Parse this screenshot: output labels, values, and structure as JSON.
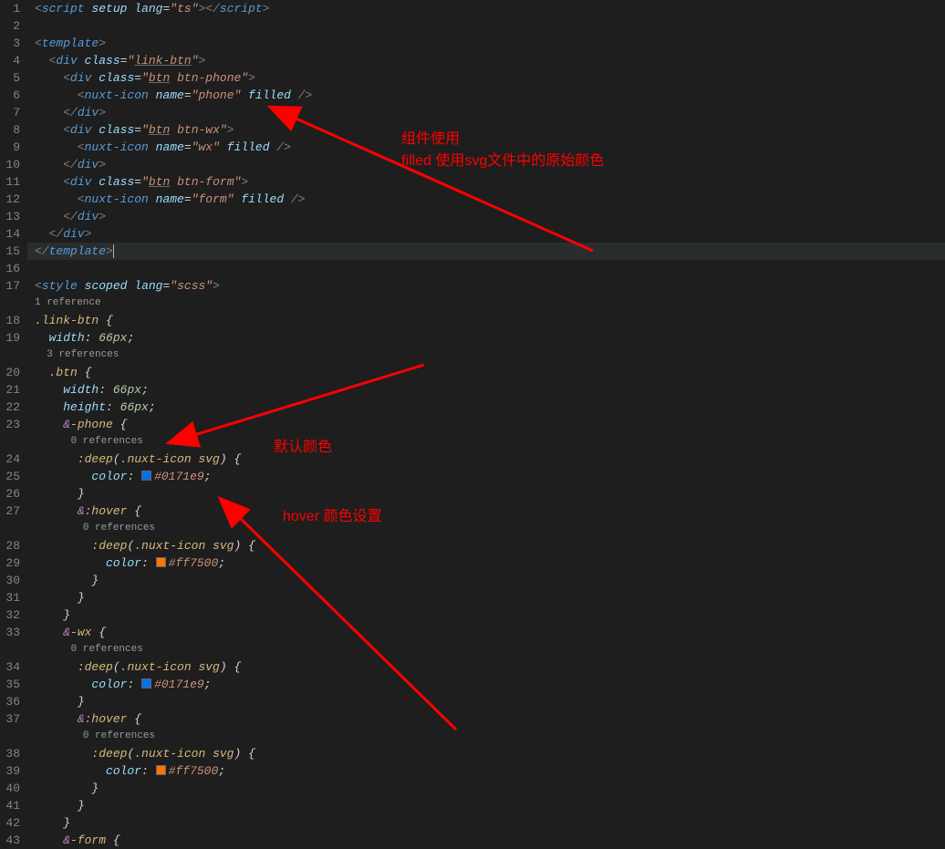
{
  "gutter": {
    "lines": [
      "1",
      "2",
      "3",
      "4",
      "5",
      "6",
      "7",
      "8",
      "9",
      "10",
      "11",
      "12",
      "13",
      "14",
      "15",
      "16",
      "17",
      "",
      "18",
      "19",
      "",
      "20",
      "21",
      "22",
      "23",
      "",
      "24",
      "25",
      "26",
      "27",
      "",
      "28",
      "29",
      "30",
      "31",
      "32",
      "33",
      "",
      "34",
      "35",
      "36",
      "37",
      "",
      "38",
      "39",
      "40",
      "41",
      "42",
      "43"
    ]
  },
  "code": {
    "l1_script": "script",
    "l1_setup": "setup",
    "l1_lang": "lang",
    "l1_ts": "\"ts\"",
    "l3_template": "template",
    "l4_div": "div",
    "l4_class": "class",
    "l4_link": "\"link-btn\"",
    "l5_div": "div",
    "l5_class": "class",
    "l5_val": "\"btn btn-phone\"",
    "l5_btn": "btn",
    "l6_tag": "nuxt-icon",
    "l6_name": "name",
    "l6_val": "\"phone\"",
    "l6_filled": "filled",
    "l7_div": "div",
    "l8_div": "div",
    "l8_class": "class",
    "l8_val": "\"btn btn-wx\"",
    "l8_btn": "btn",
    "l9_tag": "nuxt-icon",
    "l9_name": "name",
    "l9_val": "\"wx\"",
    "l9_filled": "filled",
    "l10_div": "div",
    "l11_div": "div",
    "l11_class": "class",
    "l11_val": "\"btn btn-form\"",
    "l11_btn": "btn",
    "l12_tag": "nuxt-icon",
    "l12_name": "name",
    "l12_val": "\"form\"",
    "l12_filled": "filled",
    "l13_div": "div",
    "l14_div": "div",
    "l15_template": "template",
    "l17_style": "style",
    "l17_scoped": "scoped",
    "l17_lang": "lang",
    "l17_scss": "\"scss\"",
    "ref1": "1 reference",
    "l18_sel": ".link-btn",
    "l19_prop": "width",
    "l19_val": "66px",
    "ref3": "3 references",
    "l20_sel": ".btn",
    "l21_prop": "width",
    "l21_val": "66px",
    "l22_prop": "height",
    "l22_val": "66px",
    "l23_amp": "&",
    "l23_sel": "-phone",
    "ref0a": "0 references",
    "l24_deep": ":deep",
    "l24_inner": ".nuxt-icon svg",
    "l25_prop": "color",
    "l25_val": "#0171e9",
    "l27_amp": "&",
    "l27_hover": ":hover",
    "ref0b": "0 references",
    "l28_deep": ":deep",
    "l28_inner": ".nuxt-icon svg",
    "l29_prop": "color",
    "l29_val": "#ff7500",
    "l33_amp": "&",
    "l33_sel": "-wx",
    "ref0c": "0 references",
    "l34_deep": ":deep",
    "l34_inner": ".nuxt-icon svg",
    "l35_prop": "color",
    "l35_val": "#0171e9",
    "l37_amp": "&",
    "l37_hover": ":hover",
    "ref0d": "0 references",
    "l38_deep": ":deep",
    "l38_inner": ".nuxt-icon svg",
    "l39_prop": "color",
    "l39_val": "#ff7500",
    "l43_amp": "&",
    "l43_sel": "-form"
  },
  "annotations": {
    "a1_line1": "组件使用",
    "a1_line2": "filled 使用svg文件中的原始颜色",
    "a2": "默认颜色",
    "a3": "hover 颜色设置"
  },
  "colors": {
    "blue": "#0171e9",
    "orange": "#ff7500",
    "red": "#ff0000"
  }
}
